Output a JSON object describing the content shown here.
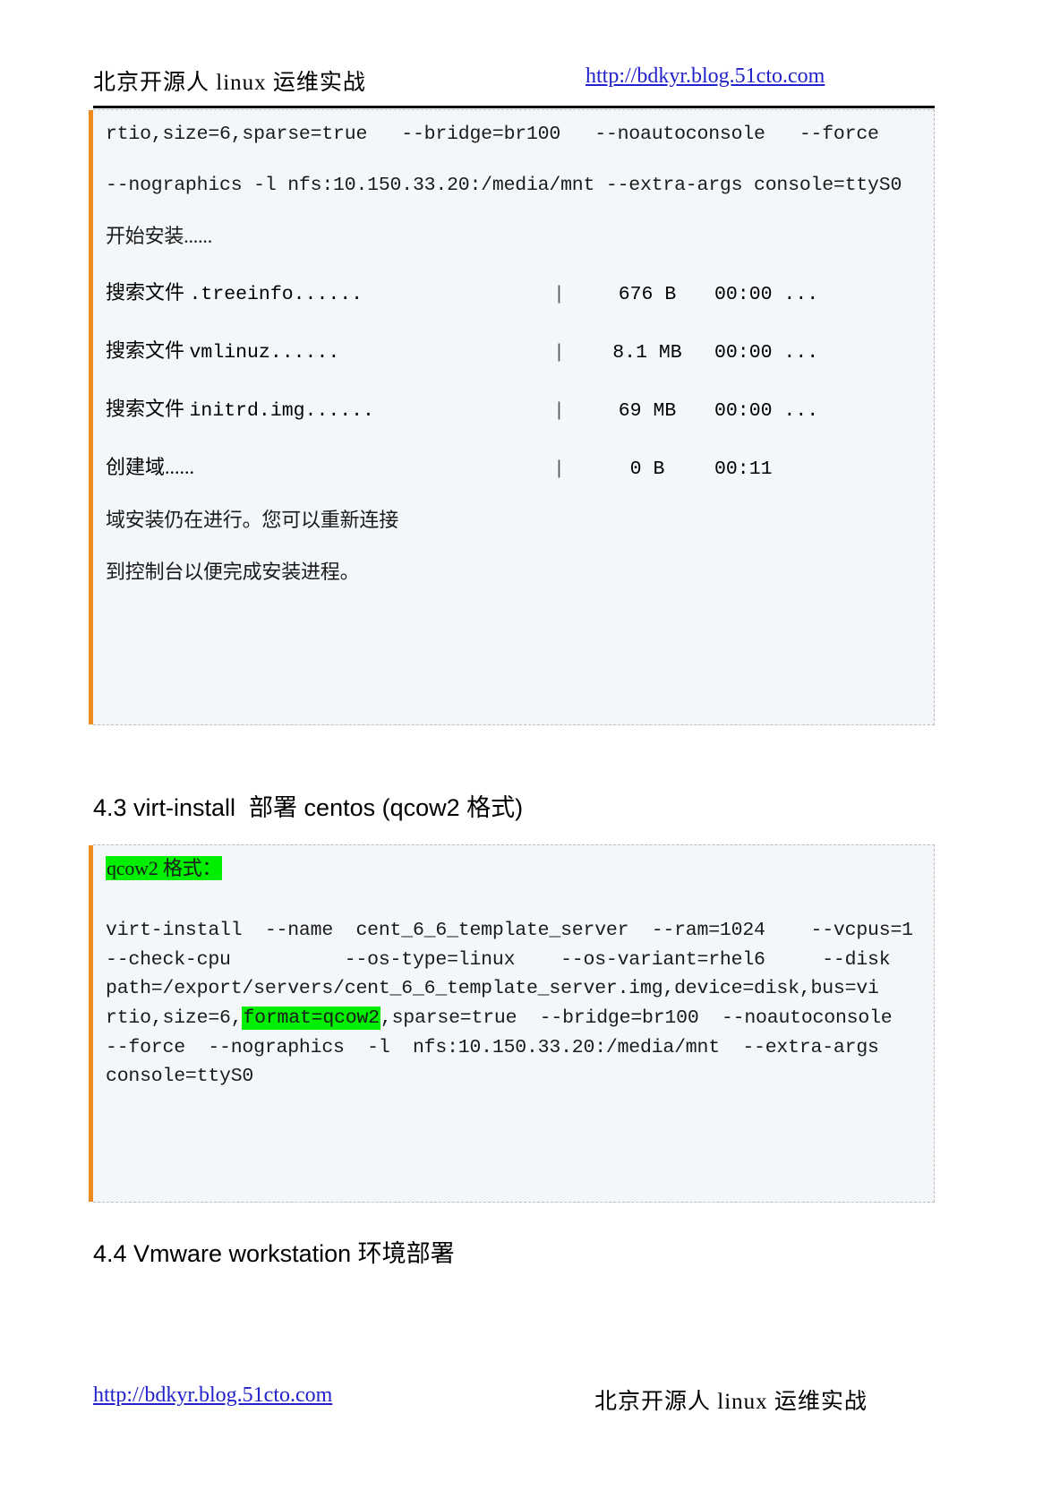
{
  "header": {
    "title": "北京开源人 linux 运维实战",
    "link": "http://bdkyr.blog.51cto.com"
  },
  "footer": {
    "link": "http://bdkyr.blog.51cto.com",
    "title": "北京开源人 linux 运维实战"
  },
  "block1": {
    "line1": "rtio,size=6,sparse=true   --bridge=br100   --noautoconsole   --force",
    "line2": "--nographics -l nfs:10.150.33.20:/media/mnt --extra-args console=ttyS0",
    "line3": "开始安装......",
    "progress": [
      {
        "label_cn": "搜索文件",
        "label_file": ".treeinfo......",
        "bar": "|",
        "size": "676 B",
        "time": "00:00 ..."
      },
      {
        "label_cn": "搜索文件",
        "label_file": "vmlinuz......",
        "bar": "|",
        "size": "8.1 MB",
        "time": "00:00 ..."
      },
      {
        "label_cn": "搜索文件",
        "label_file": "initrd.img......",
        "bar": "|",
        "size": "69 MB",
        "time": "00:00 ..."
      },
      {
        "label_cn": "创建域......",
        "label_file": "",
        "bar": "|",
        "size": "0 B",
        "time": "00:11"
      }
    ],
    "line_after1": "域安装仍在进行。您可以重新连接",
    "line_after2": "到控制台以便完成安装进程。"
  },
  "heading43": "4.3 virt-install  部署 centos (qcow2 格式)",
  "heading44": "4.4 Vmware workstation 环境部署",
  "block2": {
    "highlight_label": "qcow2 格式：",
    "line1": "virt-install  --name  cent_6_6_template_server  --ram=1024    --vcpus=1",
    "line2": "--check-cpu          --os-type=linux    --os-variant=rhel6     --disk",
    "line3": "path=/export/servers/cent_6_6_template_server.img,device=disk,bus=vi",
    "line4_pre": "rtio,size=6,",
    "line4_hl": "format=qcow2",
    "line4_post": ",sparse=true  --bridge=br100  --noautoconsole",
    "line5": "--force  --nographics  -l  nfs:10.150.33.20:/media/mnt  --extra-args",
    "line6": "console=ttyS0"
  },
  "colors": {
    "accent_bar": "#ED8B21",
    "highlight": "#00EE00",
    "code_bg": "#F4F7FA",
    "link": "#2222CC"
  }
}
